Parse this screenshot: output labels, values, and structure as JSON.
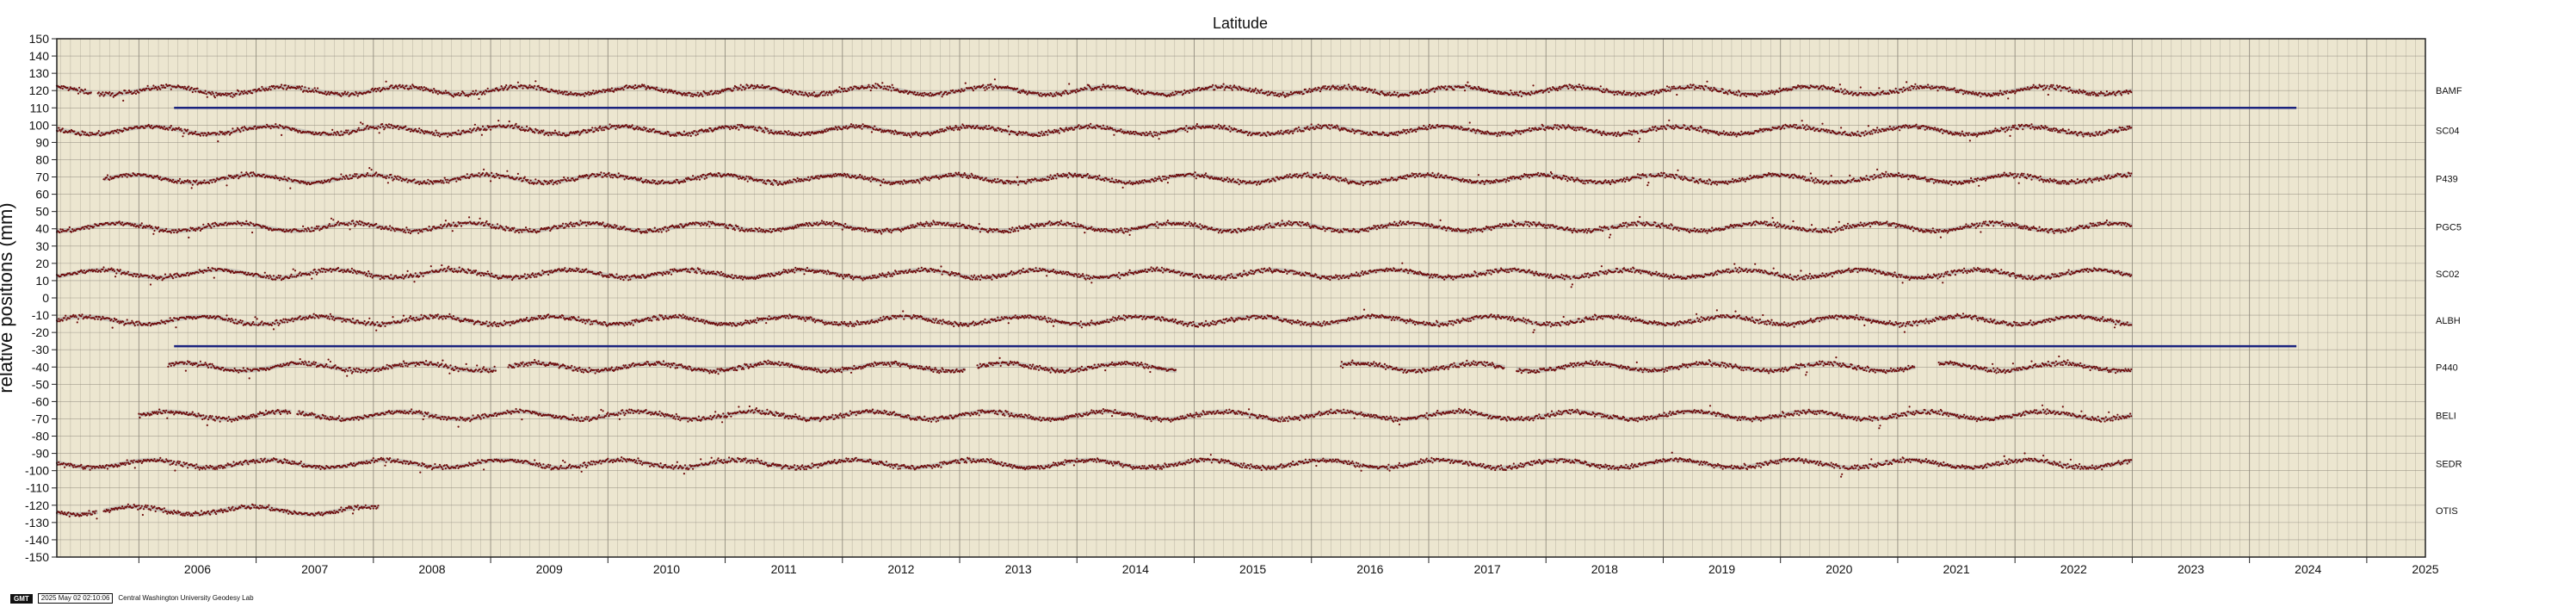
{
  "chart_data": {
    "type": "scatter",
    "title": "Latitude",
    "ylabel": "relative positions (mm)",
    "xlabel": "",
    "xlim": [
      2005.3,
      2025.5
    ],
    "ylim": [
      -150,
      150
    ],
    "grid": true,
    "x_ticks": [
      "2006",
      "2007",
      "2008",
      "2009",
      "2010",
      "2011",
      "2012",
      "2013",
      "2014",
      "2015",
      "2016",
      "2017",
      "2018",
      "2019",
      "2020",
      "2021",
      "2022",
      "2023",
      "2024",
      "2025"
    ],
    "y_ticks": [
      150,
      140,
      130,
      120,
      110,
      100,
      90,
      80,
      70,
      60,
      50,
      40,
      30,
      20,
      10,
      0,
      -10,
      -20,
      -30,
      -40,
      -50,
      -60,
      -70,
      -80,
      -90,
      -100,
      -110,
      -120,
      -130,
      -140,
      -150
    ],
    "colors": {
      "plot_background": "#ece6d0",
      "grid": "#8a8578",
      "points": "#6e0d0d",
      "model": "#aaaaaa",
      "reference_line": "#1a237e"
    },
    "reference_lines": [
      {
        "y": 110,
        "x_start": 2006.3,
        "x_end": 2024.4
      },
      {
        "y": -28,
        "x_start": 2006.3,
        "x_end": 2024.4
      }
    ],
    "series": [
      {
        "name": "BAMF",
        "offset": 120,
        "segments": [
          [
            2005.3,
            2005.6
          ],
          [
            2005.65,
            2023.0
          ]
        ]
      },
      {
        "name": "SC04",
        "offset": 97,
        "segments": [
          [
            2005.3,
            2023.0
          ]
        ]
      },
      {
        "name": "P439",
        "offset": 69,
        "segments": [
          [
            2005.7,
            2023.0
          ]
        ]
      },
      {
        "name": "PGC5",
        "offset": 41,
        "segments": [
          [
            2005.3,
            2023.0
          ]
        ]
      },
      {
        "name": "SC02",
        "offset": 14,
        "segments": [
          [
            2005.3,
            2023.0
          ]
        ]
      },
      {
        "name": "ALBH",
        "offset": -13,
        "segments": [
          [
            2005.3,
            2023.0
          ]
        ]
      },
      {
        "name": "P440",
        "offset": -40,
        "segments": [
          [
            2006.25,
            2009.05
          ],
          [
            2009.15,
            2013.05
          ],
          [
            2013.15,
            2014.85
          ],
          [
            2016.25,
            2017.65
          ],
          [
            2017.75,
            2021.15
          ],
          [
            2021.35,
            2023.0
          ]
        ]
      },
      {
        "name": "BELI",
        "offset": -68,
        "segments": [
          [
            2006.0,
            2007.3
          ],
          [
            2007.35,
            2023.0
          ]
        ]
      },
      {
        "name": "SEDR",
        "offset": -96,
        "segments": [
          [
            2005.3,
            2023.0
          ]
        ]
      },
      {
        "name": "OTIS",
        "offset": -123,
        "segments": [
          [
            2005.3,
            2005.65
          ],
          [
            2005.7,
            2008.05
          ]
        ]
      }
    ]
  },
  "footer": {
    "gmt_logo": "GMT",
    "timestamp": "2025 May 02 02:10:06",
    "credit": "Central Washington University Geodesy Lab"
  }
}
